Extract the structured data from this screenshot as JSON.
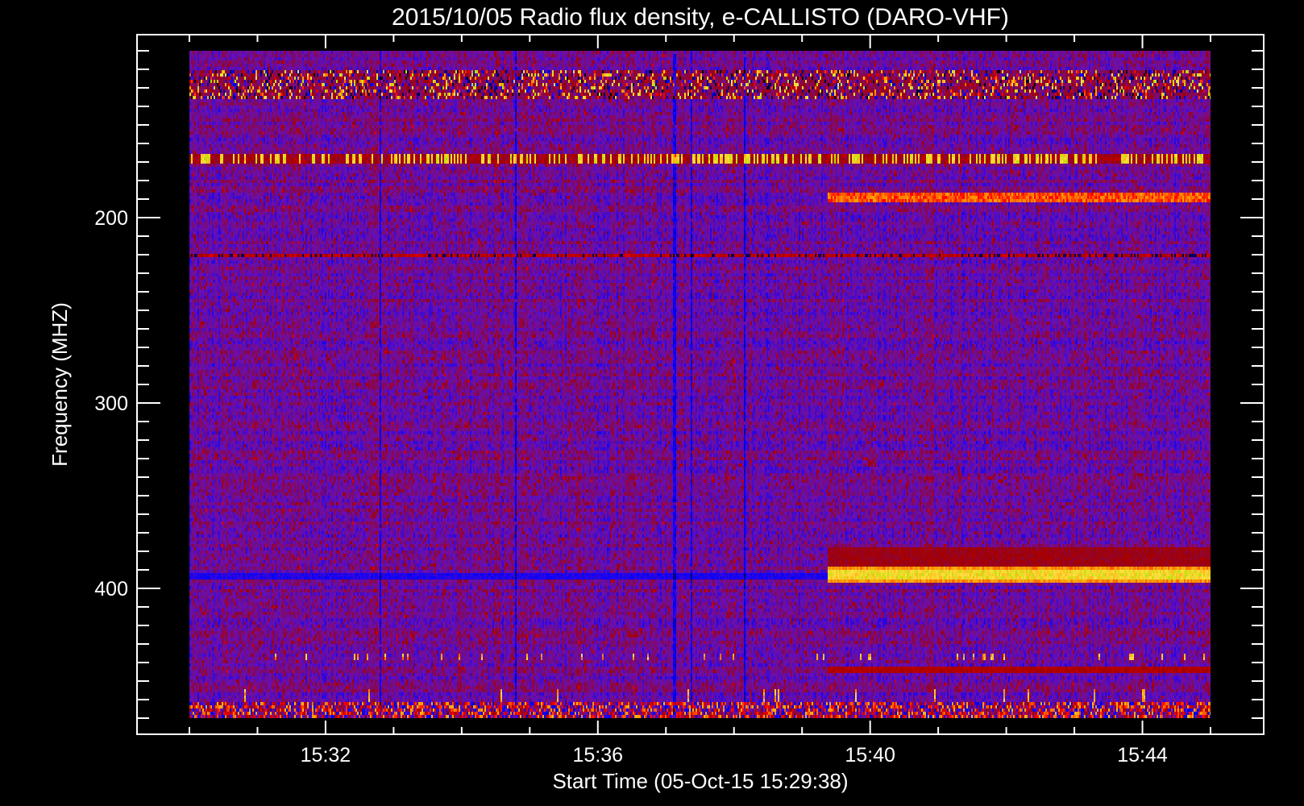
{
  "chart_data": {
    "type": "heatmap",
    "title": "2015/10/05  Radio flux density, e-CALLISTO (DARO-VHF)",
    "xlabel": "Start Time (05-Oct-15 15:29:38)",
    "ylabel": "Frequency (MHZ)",
    "xlim": [
      "15:30",
      "15:45"
    ],
    "ylim": [
      470,
      110
    ],
    "xticks": [
      {
        "minute": 2,
        "label": "15:32"
      },
      {
        "minute": 6,
        "label": "15:36"
      },
      {
        "minute": 10,
        "label": "15:40"
      },
      {
        "minute": 14,
        "label": "15:44"
      }
    ],
    "x_minor_step_min": 1,
    "yticks": [
      {
        "value": 200,
        "label": "200"
      },
      {
        "value": 300,
        "label": "300"
      },
      {
        "value": 400,
        "label": "400"
      }
    ],
    "y_minor_step_mhz": 10,
    "colormap": [
      "#000000",
      "#000078",
      "#0000ff",
      "#6a10b0",
      "#a00000",
      "#ff0000",
      "#ff9a00",
      "#ffe040",
      "#b4dc00"
    ],
    "background_level": 0.38,
    "features": [
      {
        "name": "rfi-band-speckle",
        "f": [
          120,
          136
        ],
        "t": [
          0,
          15
        ],
        "level": 0.55,
        "variance": 0.45
      },
      {
        "name": "periodic-spikes",
        "f": [
          165,
          170
        ],
        "t": [
          0,
          15
        ],
        "level": 0.92
      },
      {
        "name": "red-band",
        "f": [
          187,
          192
        ],
        "t": [
          9.37,
          15
        ],
        "level": 0.72
      },
      {
        "name": "faint-band",
        "f": [
          220,
          222
        ],
        "t": [
          0,
          15
        ],
        "level": 0.5
      },
      {
        "name": "bright-band",
        "f": [
          389,
          397
        ],
        "t": [
          9.37,
          15
        ],
        "level": 0.88
      },
      {
        "name": "purple-haze",
        "f": [
          378,
          388
        ],
        "t": [
          9.37,
          15
        ],
        "level": 0.5
      },
      {
        "name": "dark-band",
        "f": [
          391,
          396
        ],
        "t": [
          0,
          9.37
        ],
        "level": 0.25
      },
      {
        "name": "sporadic-spikes",
        "f": [
          436,
          438
        ],
        "t": [
          0,
          15
        ],
        "level": 0.75
      },
      {
        "name": "purple-band",
        "f": [
          443,
          446
        ],
        "t": [
          9.37,
          15
        ],
        "level": 0.52
      },
      {
        "name": "vertical-spikes",
        "f": [
          455,
          463
        ],
        "t": [
          0,
          15
        ],
        "level": 0.8
      },
      {
        "name": "noisy-bottom-band",
        "f": [
          462,
          470
        ],
        "t": [
          0,
          15
        ],
        "level": 0.5,
        "variance": 0.35
      }
    ],
    "dark_lines_min": [
      2.79,
      4.78,
      7.11,
      7.36,
      8.15
    ]
  }
}
